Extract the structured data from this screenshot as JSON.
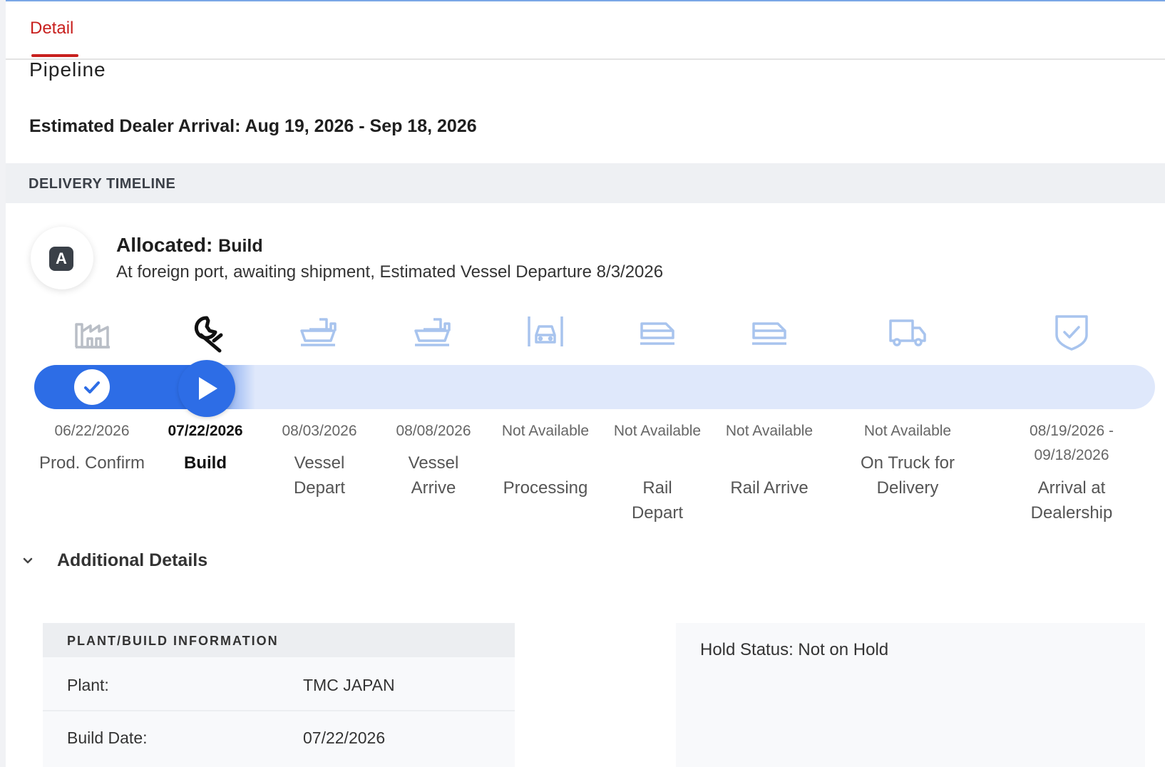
{
  "tabs": {
    "detail": "Detail"
  },
  "pipeline": {
    "title": "Pipeline",
    "estimated_arrival": "Estimated Dealer Arrival: Aug 19, 2026 - Sep 18, 2026"
  },
  "timeline": {
    "header": "DELIVERY TIMELINE",
    "status_badge": "A",
    "status_label": "Allocated:",
    "status_value": "Build",
    "status_description": "At foreign port, awaiting shipment, Estimated Vessel Departure 8/3/2026",
    "steps": [
      {
        "date": "06/22/2026",
        "label": "Prod. Confirm",
        "icon": "factory-icon",
        "state": "complete"
      },
      {
        "date": "07/22/2026",
        "label": "Build",
        "icon": "wrench-icon",
        "state": "current"
      },
      {
        "date": "08/03/2026",
        "label": "Vessel Depart",
        "icon": "ship-depart-icon",
        "state": "pending"
      },
      {
        "date": "08/08/2026",
        "label": "Vessel Arrive",
        "icon": "ship-arrive-icon",
        "state": "pending"
      },
      {
        "date": "Not Available",
        "label": "Processing",
        "icon": "processing-icon",
        "state": "pending"
      },
      {
        "date": "Not Available",
        "label": "Rail Depart",
        "icon": "rail-depart-icon",
        "state": "pending"
      },
      {
        "date": "Not Available",
        "label": "Rail Arrive",
        "icon": "rail-arrive-icon",
        "state": "pending"
      },
      {
        "date": "Not Available",
        "label": "On Truck for Delivery",
        "icon": "truck-icon",
        "state": "pending"
      },
      {
        "date": "08/19/2026 - 09/18/2026",
        "label": "Arrival at Dealership",
        "icon": "shield-check-icon",
        "state": "pending"
      }
    ]
  },
  "additional_details": {
    "label": "Additional Details"
  },
  "plant_build": {
    "header": "PLANT/BUILD INFORMATION",
    "plant_label": "Plant:",
    "plant_value": "TMC JAPAN",
    "build_date_label": "Build Date:",
    "build_date_value": "07/22/2026"
  },
  "hold_status": "Hold Status: Not on Hold",
  "colors": {
    "accent_red": "#c8201e",
    "progress_blue": "#2d6de6",
    "track_blue": "#dfe8fb",
    "pending_icon": "#a8c4ee",
    "complete_icon": "#b9bec6"
  }
}
